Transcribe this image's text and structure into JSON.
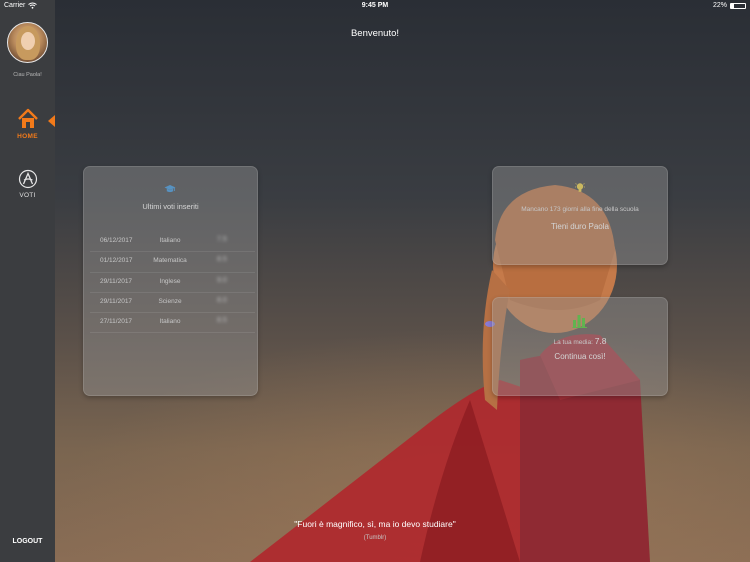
{
  "status_bar": {
    "carrier": "Carrier",
    "time": "9:45 PM",
    "battery": "22%",
    "battery_level": 0.22
  },
  "sidebar": {
    "user_name": "Ciau Paola!",
    "items": [
      {
        "label": "HOME",
        "icon": "house-icon",
        "active": true
      },
      {
        "label": "VOTI",
        "icon": "grade-a-icon",
        "active": false
      }
    ],
    "logout_label": "LOGOUT",
    "accent_color": "#f27a1a"
  },
  "main": {
    "welcome": "Benvenuto!",
    "grades_card": {
      "icon": "graduation-cap-icon",
      "title": "Ultimi voti inseriti",
      "rows": [
        {
          "date": "06/12/2017",
          "subject": "Italiano",
          "grade": "7.5"
        },
        {
          "date": "01/12/2017",
          "subject": "Matematica",
          "grade": "8.5"
        },
        {
          "date": "29/11/2017",
          "subject": "Inglese",
          "grade": "9.0"
        },
        {
          "date": "29/11/2017",
          "subject": "Scienze",
          "grade": "8.0"
        },
        {
          "date": "27/11/2017",
          "subject": "Italiano",
          "grade": "8.5"
        }
      ]
    },
    "days_card": {
      "icon": "lightbulb-icon",
      "text": "Mancano 173 giorni alla fine della scuola",
      "motto": "Tieni duro Paola"
    },
    "average_card": {
      "icon": "bar-chart-icon",
      "label": "La tua media:",
      "value": "7.8",
      "motto": "Continua così!"
    },
    "quote": {
      "text": "\"Fuori è magnifico, sì, ma io devo studiare\"",
      "author": "(Tumblr)"
    }
  }
}
